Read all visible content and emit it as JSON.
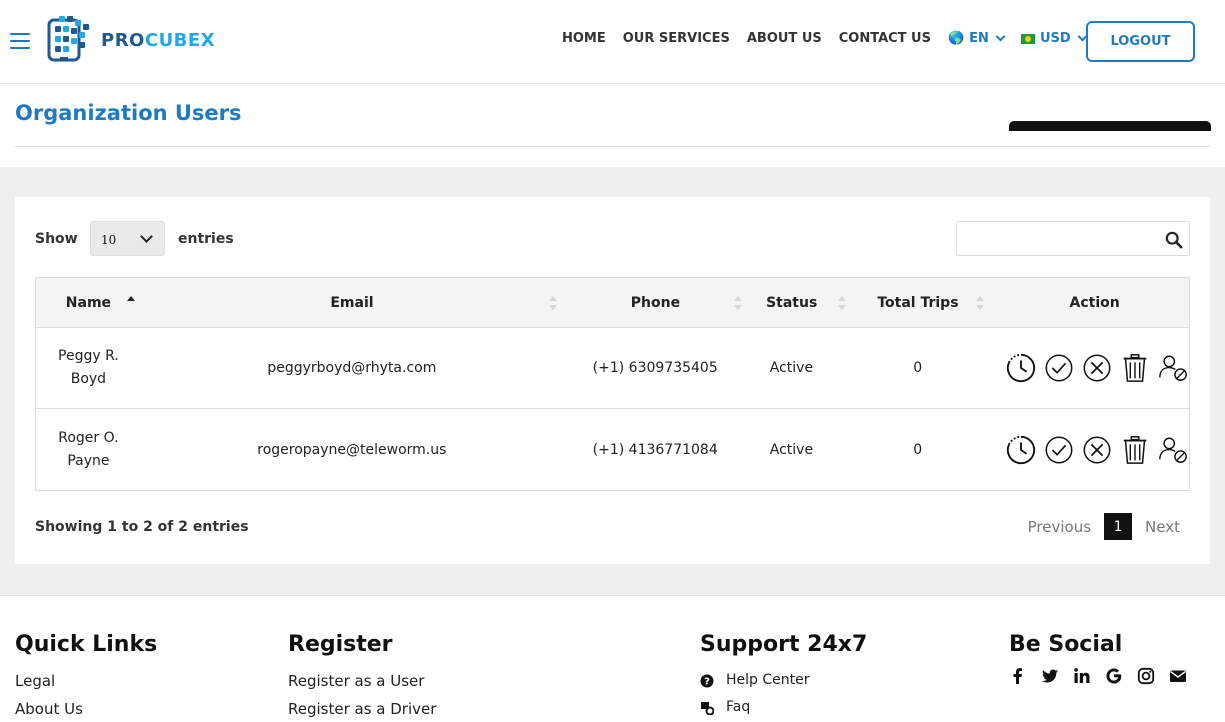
{
  "header": {
    "logo_text_1": "PRO",
    "logo_text_2": "CUBEX",
    "nav": [
      "HOME",
      "OUR SERVICES",
      "ABOUT US",
      "CONTACT US"
    ],
    "language": "EN",
    "currency": "USD",
    "logout_label": "LOGOUT"
  },
  "page": {
    "title": "Organization Users"
  },
  "table_controls": {
    "show_label": "Show",
    "entries_value": "10",
    "entries_label": "entries",
    "search_value": ""
  },
  "table": {
    "columns": [
      "Name",
      "Email",
      "Phone",
      "Status",
      "Total Trips",
      "Action"
    ],
    "rows": [
      {
        "name": "Peggy R. Boyd",
        "email": "peggyrboyd@rhyta.com",
        "phone": "(+1) 6309735405",
        "status": "Active",
        "trips": "0"
      },
      {
        "name": "Roger O. Payne",
        "email": "rogeropayne@teleworm.us",
        "phone": "(+1) 4136771084",
        "status": "Active",
        "trips": "0"
      }
    ]
  },
  "pagination": {
    "info": "Showing 1 to 2 of 2 entries",
    "previous": "Previous",
    "current": "1",
    "next": "Next"
  },
  "footer": {
    "quick_links": {
      "title": "Quick Links",
      "items": [
        "Legal",
        "About Us"
      ]
    },
    "register": {
      "title": "Register",
      "items": [
        "Register as a User",
        "Register as a Driver"
      ]
    },
    "support": {
      "title": "Support 24x7",
      "items": [
        "Help Center",
        "Faq"
      ]
    },
    "social": {
      "title": "Be Social",
      "icons": [
        "facebook-icon",
        "twitter-icon",
        "linkedin-icon",
        "google-icon",
        "instagram-icon",
        "envelope-icon"
      ]
    }
  },
  "colors": {
    "brand": "#1f7ac0",
    "brand_light": "#22a7e8",
    "gray_bg": "#efefef"
  }
}
